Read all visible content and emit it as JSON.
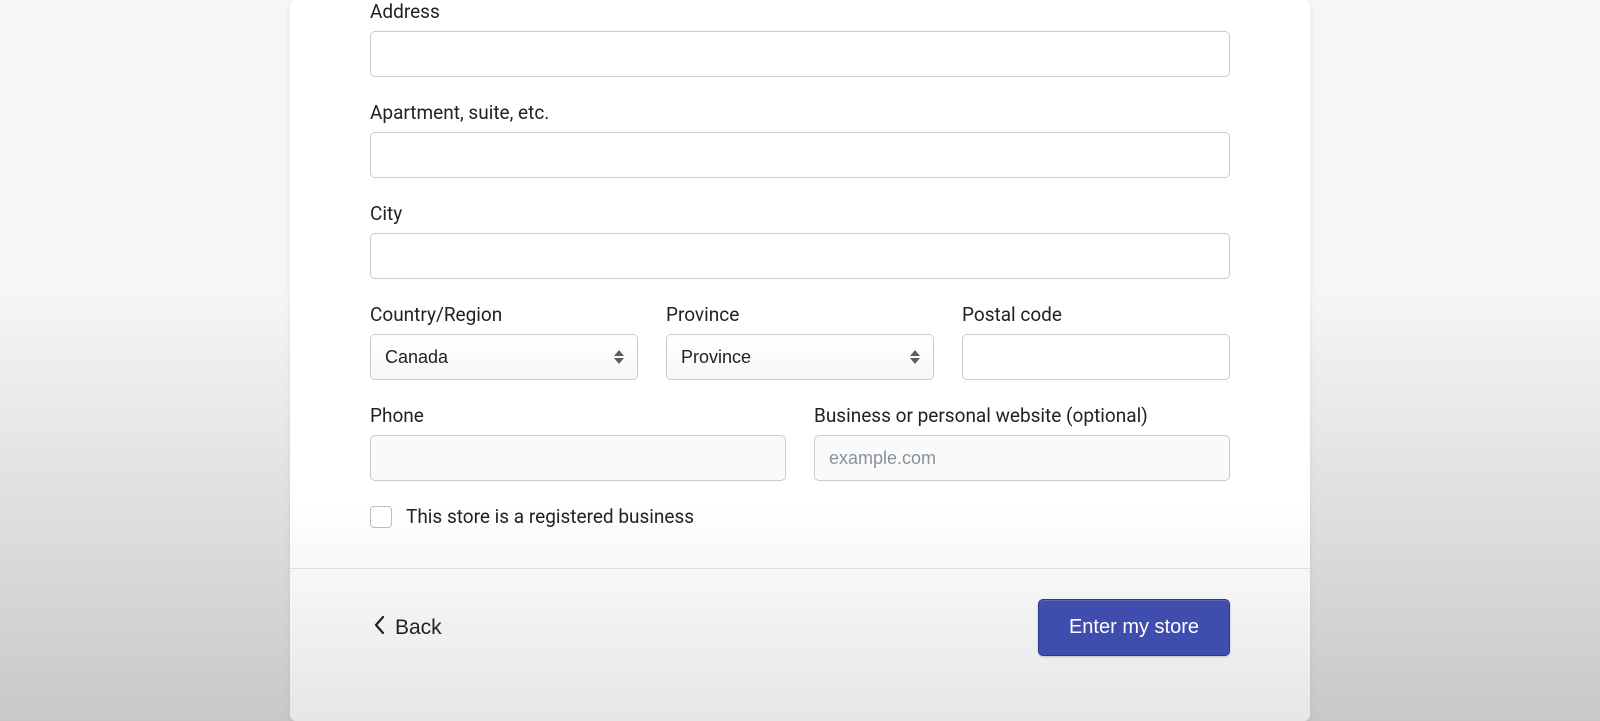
{
  "form": {
    "address_label": "Address",
    "address_value": "",
    "apt_label": "Apartment, suite, etc.",
    "apt_value": "",
    "city_label": "City",
    "city_value": "",
    "country_label": "Country/Region",
    "country_value": "Canada",
    "province_label": "Province",
    "province_value": "Province",
    "postal_label": "Postal code",
    "postal_value": "",
    "phone_label": "Phone",
    "phone_value": "",
    "website_label": "Business or personal website (optional)",
    "website_placeholder": "example.com",
    "website_value": "",
    "registered_label": "This store is a registered business"
  },
  "footer": {
    "back_label": "Back",
    "primary_label": "Enter my store"
  }
}
